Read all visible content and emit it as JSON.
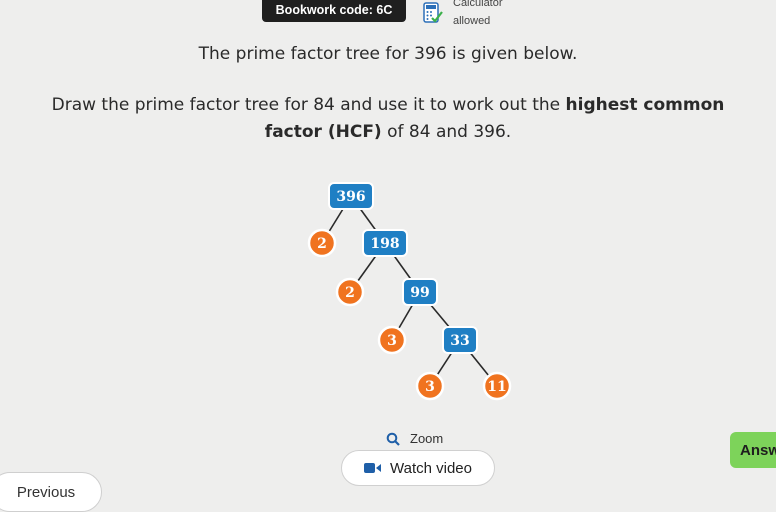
{
  "header": {
    "bookwork_label": "Bookwork code: 6C",
    "calculator_line1": "Calculator",
    "calculator_line2": "allowed",
    "calculator_icon": "calculator-icon"
  },
  "question": {
    "line1": "The prime factor tree for 396 is given below.",
    "line2_plain": "Draw the prime factor tree for 84 and use it to work out the ",
    "line2_bold": "highest common",
    "line3_bold": "factor (HCF)",
    "line3_plain": " of 84 and 396."
  },
  "tree": {
    "nodes": [
      {
        "label": "396",
        "kind": "composite"
      },
      {
        "label": "2",
        "kind": "prime"
      },
      {
        "label": "198",
        "kind": "composite"
      },
      {
        "label": "2",
        "kind": "prime"
      },
      {
        "label": "99",
        "kind": "composite"
      },
      {
        "label": "3",
        "kind": "prime"
      },
      {
        "label": "33",
        "kind": "composite"
      },
      {
        "label": "3",
        "kind": "prime"
      },
      {
        "label": "11",
        "kind": "prime"
      }
    ],
    "colors": {
      "composite": "#1f7fc4",
      "prime": "#f0731f"
    }
  },
  "controls": {
    "zoom_label": "Zoom",
    "zoom_icon": "search-icon",
    "answer_label": "Answ",
    "watch_video_label": "Watch video",
    "video_icon": "video-icon",
    "previous_label": "Previous"
  }
}
